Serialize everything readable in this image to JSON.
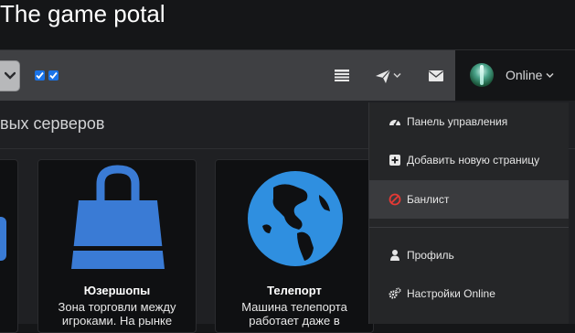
{
  "site": {
    "title": "The game potal"
  },
  "navbar": {
    "user": {
      "status": "Online"
    }
  },
  "section": {
    "title_fragment": "вых серверов"
  },
  "cards": [
    {
      "title": "Юзершопы",
      "desc_line1": "Зона торговли между",
      "desc_line2": "игроками. На рынке"
    },
    {
      "title": "Телепорт",
      "desc_line1": "Машина телепорта",
      "desc_line2": "работает даже в"
    }
  ],
  "user_menu": {
    "items": [
      {
        "label": "Панель управления",
        "icon": "dashboard-icon"
      },
      {
        "label": "Добавить новую страницу",
        "icon": "plus-square-icon"
      },
      {
        "label": "Банлист",
        "icon": "ban-icon"
      },
      {
        "label": "Профиль",
        "icon": "user-icon"
      },
      {
        "label": "Настройки Online",
        "icon": "cogs-icon"
      }
    ]
  },
  "colors": {
    "navbar": "#3f4043",
    "accent_blue": "#3a7bd5",
    "ban_red": "#e53935",
    "card_bg": "#0f1012"
  }
}
